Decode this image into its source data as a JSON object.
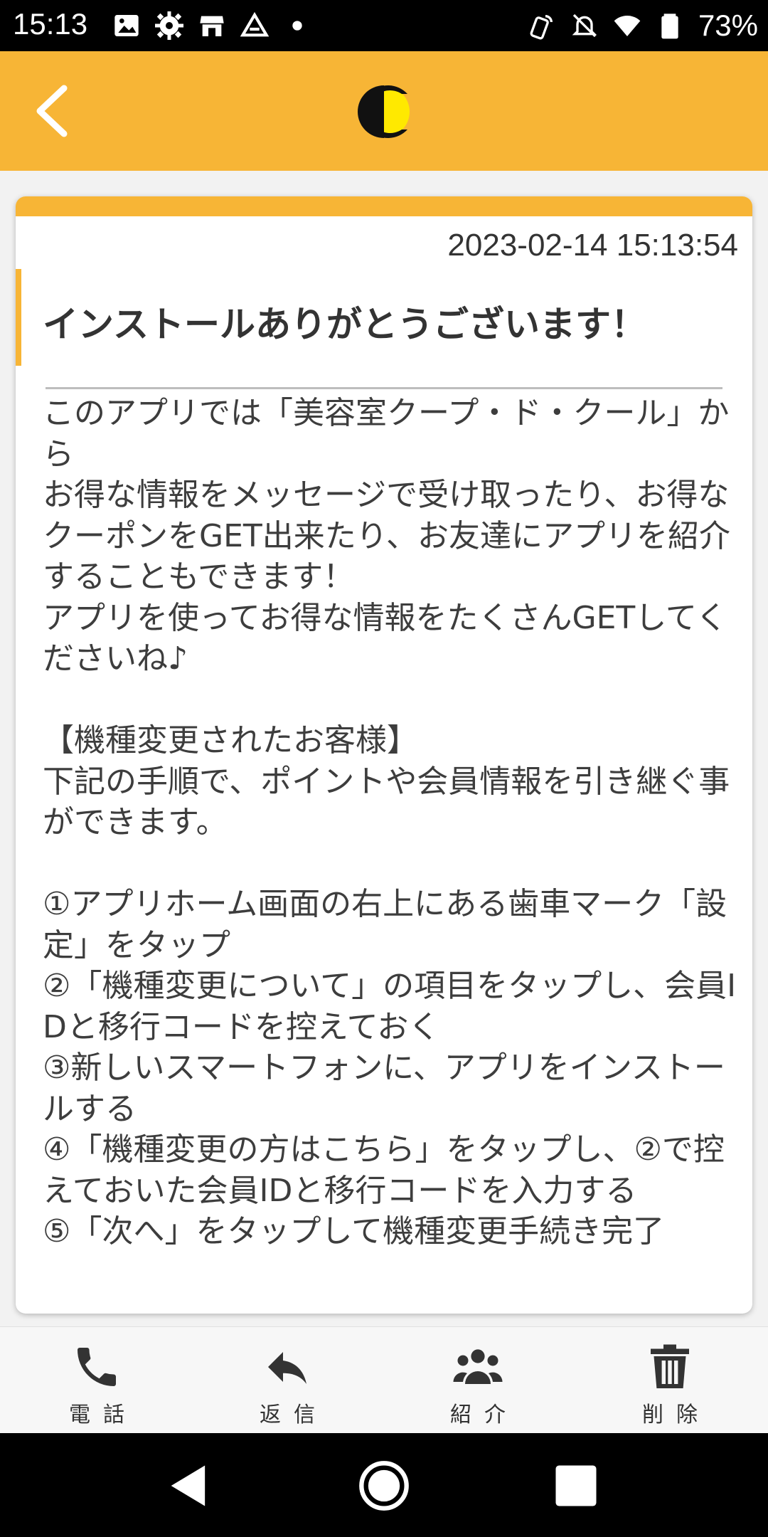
{
  "status_bar": {
    "time": "15:13",
    "battery": "73%"
  },
  "header": {
    "logo_letter": "C",
    "colors": {
      "header_bg": "#f7b536",
      "logo_fill": "#ffe900"
    }
  },
  "message": {
    "timestamp": "2023-02-14 15:13:54",
    "title": "インストールありがとうございます！",
    "body": "このアプリでは「美容室クープ・ド・クール」から\nお得な情報をメッセージで受け取ったり、お得なクーポンをGET出来たり、お友達にアプリを紹介することもできます！\nアプリを使ってお得な情報をたくさんGETしてくださいね♪\n\n【機種変更されたお客様】\n下記の手順で、ポイントや会員情報を引き継ぐ事ができます。\n\n①アプリホーム画面の右上にある歯車マーク「設定」をタップ\n②「機種変更について」の項目をタップし、会員IDと移行コードを控えておく\n③新しいスマートフォンに、アプリをインストールする\n④「機種変更の方はこちら」をタップし、②で控えておいた会員IDと移行コードを入力する\n⑤「次へ」をタップして機種変更手続き完了"
  },
  "actions": [
    {
      "label": "電話",
      "icon": "phone-icon"
    },
    {
      "label": "返信",
      "icon": "reply-icon"
    },
    {
      "label": "紹介",
      "icon": "group-icon"
    },
    {
      "label": "削除",
      "icon": "trash-icon"
    }
  ]
}
